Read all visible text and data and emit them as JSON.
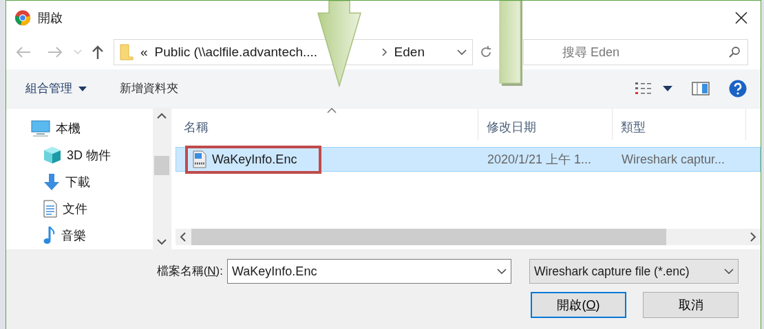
{
  "window": {
    "title": "開啟"
  },
  "address": {
    "overflow": "«",
    "segments": [
      "Public (\\\\aclfile.advantech....",
      "Eden"
    ]
  },
  "search": {
    "placeholder": "搜尋 Eden"
  },
  "toolbar": [
    {
      "label": "組合管理",
      "dropdown": true
    },
    {
      "label": "新增資料夾",
      "dropdown": false
    }
  ],
  "sidebar": {
    "items": [
      {
        "label": "本機",
        "kind": "computer",
        "children": [
          {
            "label": "3D 物件",
            "kind": "cube"
          },
          {
            "label": "下載",
            "kind": "download"
          },
          {
            "label": "文件",
            "kind": "document"
          },
          {
            "label": "音樂",
            "kind": "music"
          }
        ]
      }
    ]
  },
  "table": {
    "columns": [
      {
        "label": "名稱",
        "sorted": true
      },
      {
        "label": "修改日期",
        "sorted": false
      },
      {
        "label": "類型",
        "sorted": false
      }
    ],
    "rows": [
      {
        "name": "WaKeyInfo.Enc",
        "modified": "2020/1/21 上午 1...",
        "type": "Wireshark captur...",
        "selected": true,
        "highlighted": true
      }
    ]
  },
  "file_name": {
    "label_before": "檔案名稱(",
    "access_key": "N",
    "label_after": "):",
    "value": "WaKeyInfo.Enc"
  },
  "file_type": {
    "value": "Wireshark capture file (*.enc)"
  },
  "buttons": [
    {
      "label_before": "開啟(",
      "access_key": "O",
      "label_after": ")",
      "default": true
    },
    {
      "label_before": "取消",
      "default": false
    }
  ],
  "annotations": {
    "down_arrow": true,
    "bar": true
  }
}
